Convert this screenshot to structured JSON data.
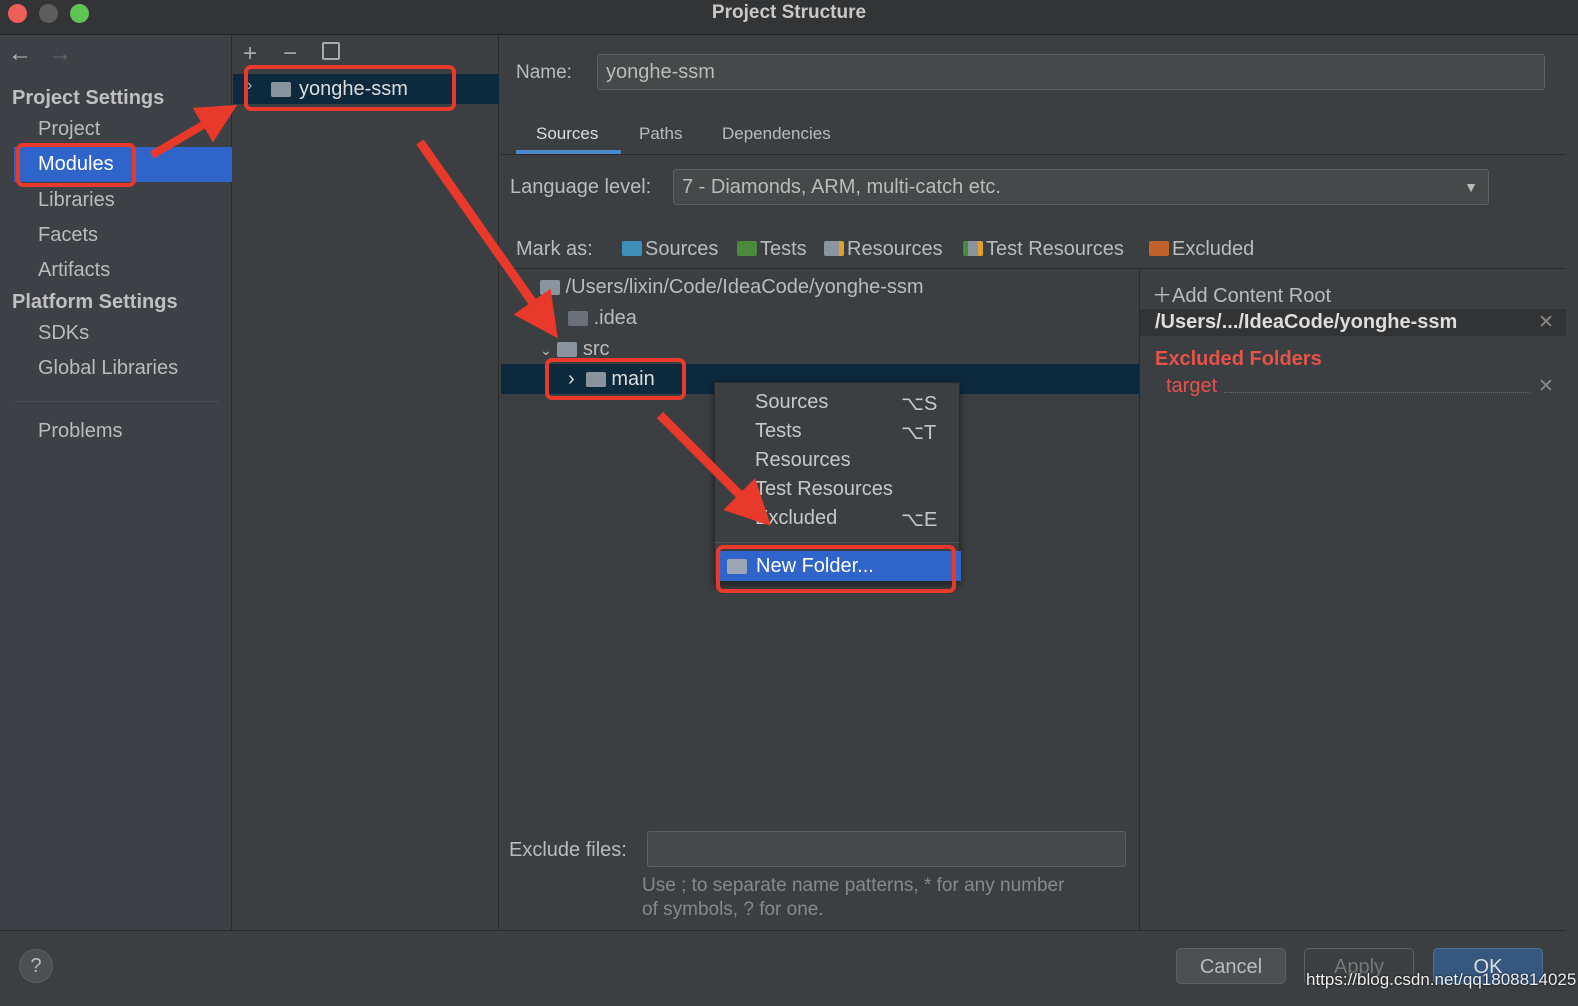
{
  "window": {
    "title": "Project Structure"
  },
  "sidebar": {
    "sections": [
      {
        "label": "Project Settings",
        "items": [
          "Project",
          "Modules",
          "Libraries",
          "Facets",
          "Artifacts"
        ]
      },
      {
        "label": "Platform Settings",
        "items": [
          "SDKs",
          "Global Libraries"
        ]
      }
    ],
    "problems": "Problems",
    "selected": "Modules"
  },
  "modules": {
    "toolbar": {
      "add": "+",
      "remove": "−",
      "copy": "copy-icon"
    },
    "items": [
      "yonghe-ssm"
    ]
  },
  "details": {
    "name_label": "Name:",
    "name_value": "yonghe-ssm",
    "tabs": [
      "Sources",
      "Paths",
      "Dependencies"
    ],
    "active_tab": "Sources",
    "language_label": "Language level:",
    "language_value": "7 - Diamonds, ARM, multi-catch etc.",
    "mark_as_label": "Mark as:",
    "mark_as": [
      {
        "label": "Sources",
        "color": "#3d8fb5"
      },
      {
        "label": "Tests",
        "color": "#4b8a3c"
      },
      {
        "label": "Resources",
        "color": "#8a949e"
      },
      {
        "label": "Test Resources",
        "color": "#8a949e"
      },
      {
        "label": "Excluded",
        "color": "#c0622b"
      }
    ],
    "tree": {
      "root": "/Users/lixin/Code/IdeaCode/yonghe-ssm",
      "idea": ".idea",
      "src": "src",
      "main": "main"
    },
    "exclude_label": "Exclude files:",
    "exclude_value": "",
    "hint_line1": "Use ; to separate name patterns, * for any number",
    "hint_line2": "of symbols, ? for one."
  },
  "content_root": {
    "add_label": "Add Content Root",
    "path": "/Users/.../IdeaCode/yonghe-ssm",
    "excluded_title": "Excluded Folders",
    "excluded": [
      "target"
    ]
  },
  "context_menu": {
    "items": [
      {
        "label": "Sources",
        "shortcut": "⌥S"
      },
      {
        "label": "Tests",
        "shortcut": "⌥T"
      },
      {
        "label": "Resources",
        "shortcut": ""
      },
      {
        "label": "Test Resources",
        "shortcut": ""
      },
      {
        "label": "Excluded",
        "shortcut": "⌥E"
      }
    ],
    "new_folder": "New Folder..."
  },
  "footer": {
    "help": "?",
    "cancel": "Cancel",
    "apply": "Apply",
    "ok": "OK"
  },
  "watermark": "https://blog.csdn.net/qq1808814025",
  "colors": {
    "selection": "#2f65ca",
    "tree_selection": "#0d293e",
    "annotation": "#e8392b",
    "excluded": "#e5524a"
  }
}
